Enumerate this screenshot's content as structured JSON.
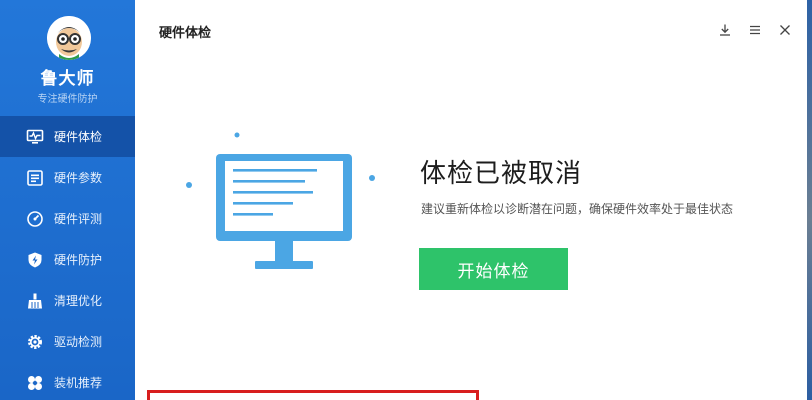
{
  "sidebar": {
    "brand": "鲁大师",
    "subtitle": "专注硬件防护",
    "items": [
      {
        "label": "硬件体检",
        "icon": "monitor-pulse-icon",
        "active": true
      },
      {
        "label": "硬件参数",
        "icon": "hardware-params-icon",
        "active": false
      },
      {
        "label": "硬件评测",
        "icon": "speedometer-icon",
        "active": false
      },
      {
        "label": "硬件防护",
        "icon": "shield-bolt-icon",
        "active": false
      },
      {
        "label": "清理优化",
        "icon": "broom-icon",
        "active": false
      },
      {
        "label": "驱动检测",
        "icon": "gear-icon",
        "active": false
      },
      {
        "label": "装机推荐",
        "icon": "puzzle-icon",
        "active": false
      }
    ]
  },
  "header": {
    "title": "硬件体检",
    "controls": [
      "download-icon",
      "menu-icon",
      "close-icon"
    ]
  },
  "main": {
    "headline": "体检已被取消",
    "description": "建议重新体检以诊断潜在问题，确保硬件效率处于最佳状态",
    "start_button": "开始体检"
  },
  "colors": {
    "sidebar": "#1f70d3",
    "active_item": "#1452a8",
    "accent_green": "#2ec36a",
    "illustration_blue": "#4ba6e4",
    "highlight_red": "#d81e1e"
  }
}
